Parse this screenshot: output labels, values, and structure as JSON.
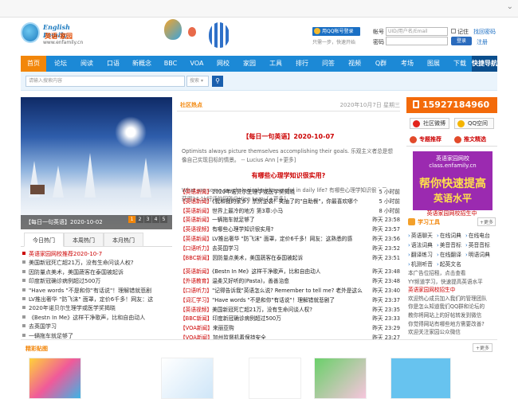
{
  "header": {
    "logo_en": "English Family",
    "logo_cn": "英语·家园",
    "logo_url": "www.enfamily.cn",
    "qq_login": "用QQ帐号登录",
    "qq_note": "只需一步，快速开始",
    "account_label": "帐号",
    "account_placeholder": "UID/用户名/Email",
    "remember_label": "记住",
    "forgot_label": "找回密码",
    "password_label": "密码",
    "login_button": "登录",
    "register_link": "注册"
  },
  "nav": {
    "items": [
      "首页",
      "论坛",
      "阅读",
      "口语",
      "新概念",
      "BBC",
      "VOA",
      "网校",
      "家园",
      "工具",
      "排行",
      "问答",
      "视频",
      "Q群",
      "考场",
      "图展",
      "下载",
      "快捷导航"
    ]
  },
  "search": {
    "placeholder": "请输入搜索内容",
    "select": "搜索",
    "select_arrow": "▾"
  },
  "hero": {
    "caption": "【每日一句英语】2020-10-02",
    "dots": [
      "1",
      "2",
      "3",
      "4",
      "5"
    ]
  },
  "left_tabs": [
    "今日热门",
    "本周热门",
    "本月热门"
  ],
  "hot_list": [
    {
      "text": "英语家园网校推荐2020-10-7",
      "red": true
    },
    {
      "text": "美国新冠死亡超21万，没有生命问谈人权?",
      "red": false
    },
    {
      "text": "因防量点美术，美国蔬客在泰国被起诉",
      "red": false
    },
    {
      "text": "印度新冠确诊病例超过500万",
      "red": false
    },
    {
      "text": "\"Have words \"不是和你\"有话说\"！理解错就悲剧",
      "red": false
    },
    {
      "text": "LV推出奢华 \"防飞沫\" 面罩，定价6千多！网友：这",
      "red": false
    },
    {
      "text": "2020年诺贝尔生理学或医学奖揭晓",
      "red": false
    },
    {
      "text": "《Bestn In Me》这样干净歌声，比和自由动人",
      "red": false
    },
    {
      "text": "去英国学习",
      "red": false
    },
    {
      "text": "一辆拖车就足够了",
      "red": false
    }
  ],
  "mid": {
    "section_title": "社区热点",
    "date": "2020年10月7日 星期三",
    "article1_title": "【每日一句英语】2020-10-07",
    "article1_body": "Optimists always picture themselves accomplishing their goals. 乐观主义者总是想像自己实现目标的情景。 -- Lucius Ann [+更多]",
    "article2_title": "有哪些心理学知识很实用?",
    "article2_body": "What are some psychological tricks, useful in daily life? 有哪些心理学知识很实用? 获得24.1k好评的回答@Hien Lam: [+更多]"
  },
  "news": [
    {
      "cat": "【英语新闻】",
      "title": "2020年诺贝尔生理学或医学奖揭晓",
      "time": "5 小时前"
    },
    {
      "cat": "【英语新闻】",
      "title": "《我和我的家乡》票房逆袭！笑抽了的\"自助餐\"，你最喜欢哪个",
      "time": "5 小时前"
    },
    {
      "cat": "【英语新闻】",
      "title": "世界上最冷的地方 第3章:小马",
      "time": "8 小时前"
    },
    {
      "cat": "【英语新闻】",
      "title": "一辆拖车就足够了",
      "time": "昨天 23:58"
    },
    {
      "cat": "【英语视频】",
      "title": "有哪些心理学知识很实用?",
      "time": "昨天 23:57"
    },
    {
      "cat": "【英语新闻】",
      "title": "LV推出奢华 \"防飞沫\" 面罩，定价6千多！网友：这熟悉的感",
      "time": "昨天 23:56"
    },
    {
      "cat": "【口语听力】",
      "title": "去英国学习",
      "time": "昨天 23:52"
    },
    {
      "cat": "【BBC新闻】",
      "title": "因防量点美术，美国蔬客在泰国被起诉",
      "time": "昨天 23:51"
    },
    {
      "cat": "【英语新闻】",
      "title": "《Bestn In Me》这样干净歌声，比和自由动人",
      "time": "昨天 23:48"
    },
    {
      "cat": "【外语教育】",
      "title": "温柔又好听的(Pasta)，善善治愈",
      "time": "昨天 23:48"
    },
    {
      "cat": "【口语听力】",
      "title": "\"记得告诉我\"英语怎么说? Remember to tell me? 老外是这么",
      "time": "昨天 23:40"
    },
    {
      "cat": "【词汇学习】",
      "title": "\"Have words \"不是和你\"有话说\"！理解错就悲剧了",
      "time": "昨天 23:37"
    },
    {
      "cat": "【英语视频】",
      "title": "美国新冠死亡超21万，没有生命问谈人权?",
      "time": "昨天 23:35"
    },
    {
      "cat": "【BBC新闻】",
      "title": "印度新冠确诊病例超过500万",
      "time": "昨天 23:33"
    },
    {
      "cat": "【VOA新闻】",
      "title": "来丽亚购",
      "time": "昨天 23:29"
    },
    {
      "cat": "【VOA新闻】",
      "title": "加州监督机着保持安全",
      "time": "昨天 23:27"
    }
  ],
  "right": {
    "phone": "15927184960",
    "weibo": "社区微博",
    "qzone": "QQ空间",
    "tab1": "专题推荐",
    "tab2": "推文精选",
    "banner_line1": "英语家园网校",
    "banner_line2": "class.enfamily.cn",
    "banner_line3": "帮你快速提高",
    "banner_line4": "英语水平",
    "banner_caption": "英语家园网校招生中",
    "tools_title": "学习工具",
    "tools_more": "+更多",
    "tools": [
      [
        "英语聊天",
        "在线词典",
        "在线电台"
      ],
      [
        "语法词典",
        "美音音标",
        "英音音标"
      ],
      [
        "翻译练习",
        "在线翻译",
        "明语词典"
      ],
      [
        "机测听音",
        "起英文名"
      ]
    ],
    "ad_text": "本广告位招租，点击查看",
    "ad_text2": "YY频道学习，快速提高英语水平",
    "ad_text3": "欢迎热心成员加入我们的管理团队",
    "ad_text4": "你是怎么知道我们QQ群和论坛的",
    "ad_text5": "教你将网站上的好帖转发到微信",
    "ad_text6": "你觉得网站有哪些地方需要改善?",
    "ad_text7": "欢迎关注家园公众微信"
  },
  "bottom": {
    "title": "精彩贴图",
    "more": "+更多"
  },
  "colors": {
    "nav_blue": "#1c89d6",
    "accent_orange": "#f2860a",
    "news_red": "#c00000"
  }
}
